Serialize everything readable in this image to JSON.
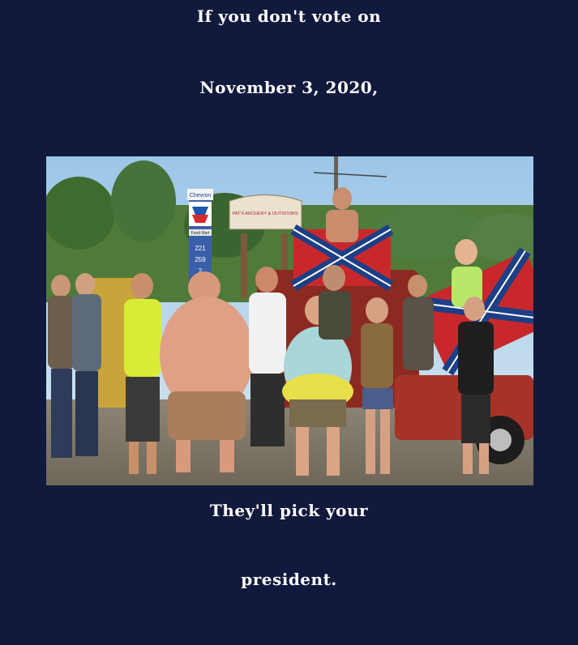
{
  "caption": {
    "top_line_1": "If you don't vote on",
    "top_line_2": "November 3, 2020,",
    "bottom_line_1": "They'll pick your",
    "bottom_line_2": "president."
  },
  "photo": {
    "signs": {
      "gas_brand": "Chevron",
      "store_sign": "PAT'S ARCHERY & OUTDOORS",
      "food_mart": "Food Mart",
      "price_1": "221",
      "price_2": "259",
      "price_3": "2"
    }
  },
  "colors": {
    "background": "#111a3c",
    "caption_text": "#ffffff"
  }
}
